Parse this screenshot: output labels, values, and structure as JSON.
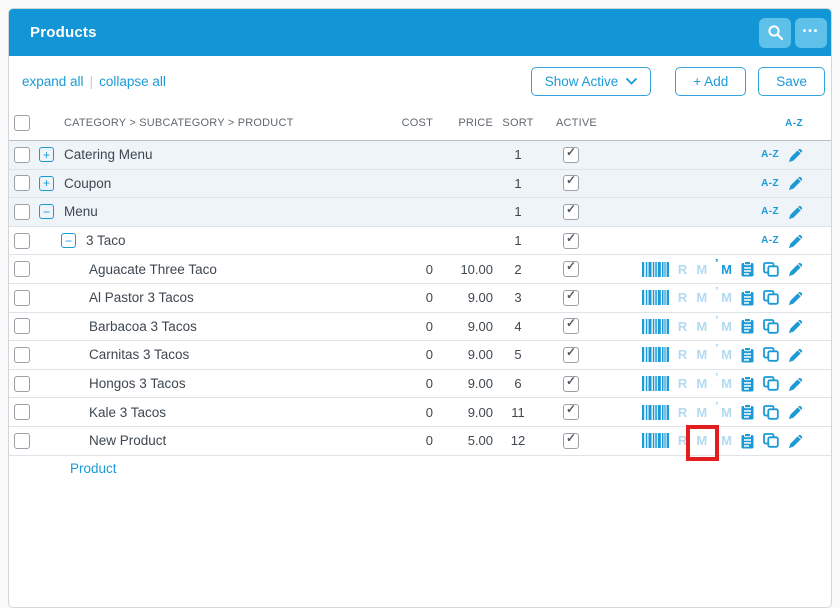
{
  "header": {
    "title": "Products",
    "search_icon": "magnifier",
    "more_icon": "ellipsis"
  },
  "toolbar": {
    "expand_all": "expand all",
    "collapse_all": "collapse all",
    "divider": "|",
    "filter_label": "Show Active",
    "add_label": "+ Add",
    "save_label": "Save"
  },
  "table": {
    "columns": {
      "category": "CATEGORY > SUBCATEGORY > PRODUCT",
      "cost": "COST",
      "price": "PRICE",
      "sort": "SORT",
      "active": "ACTIVE",
      "az": "A-Z"
    },
    "az_label": "A-Z",
    "icon_letters": {
      "r": "R",
      "m": "M",
      "mod": "M"
    },
    "rows": [
      {
        "type": "category",
        "name": "Catering Menu",
        "expand": "plus",
        "cost": "",
        "price": "",
        "sort": "1",
        "active": true,
        "tinted": true
      },
      {
        "type": "category",
        "name": "Coupon",
        "expand": "plus",
        "cost": "",
        "price": "",
        "sort": "1",
        "active": true,
        "tinted": true
      },
      {
        "type": "category",
        "name": "Menu",
        "expand": "minus",
        "cost": "",
        "price": "",
        "sort": "1",
        "active": true,
        "tinted": true
      },
      {
        "type": "subcategory",
        "name": "3 Taco",
        "expand": "minus",
        "cost": "",
        "price": "",
        "sort": "1",
        "active": true,
        "tinted": false
      },
      {
        "type": "product",
        "name": "Aguacate Three Taco",
        "cost": "0",
        "price": "10.00",
        "sort": "2",
        "active": true,
        "mod_enabled": true,
        "highlight_m": false
      },
      {
        "type": "product",
        "name": "Al Pastor 3 Tacos",
        "cost": "0",
        "price": "9.00",
        "sort": "3",
        "active": true,
        "mod_enabled": false,
        "highlight_m": false
      },
      {
        "type": "product",
        "name": "Barbacoa 3 Tacos",
        "cost": "0",
        "price": "9.00",
        "sort": "4",
        "active": true,
        "mod_enabled": false,
        "highlight_m": false
      },
      {
        "type": "product",
        "name": "Carnitas 3 Tacos",
        "cost": "0",
        "price": "9.00",
        "sort": "5",
        "active": true,
        "mod_enabled": false,
        "highlight_m": false
      },
      {
        "type": "product",
        "name": "Hongos 3 Tacos",
        "cost": "0",
        "price": "9.00",
        "sort": "6",
        "active": true,
        "mod_enabled": false,
        "highlight_m": false
      },
      {
        "type": "product",
        "name": "Kale 3 Tacos",
        "cost": "0",
        "price": "9.00",
        "sort": "11",
        "active": true,
        "mod_enabled": false,
        "highlight_m": false
      },
      {
        "type": "product",
        "name": "New Product",
        "cost": "0",
        "price": "5.00",
        "sort": "12",
        "active": true,
        "mod_enabled": false,
        "highlight_m": true
      }
    ],
    "partial_row_label": "Product"
  },
  "colors": {
    "header_bg": "#1396d5",
    "header_btn_bg": "#5ec1ea",
    "accent_blue": "#1b9ad6",
    "faded_icon_blue": "#b3daf1",
    "row_tint": "#eef4f8",
    "highlight_red": "#e21e1e",
    "text_dark": "#3e4750"
  }
}
